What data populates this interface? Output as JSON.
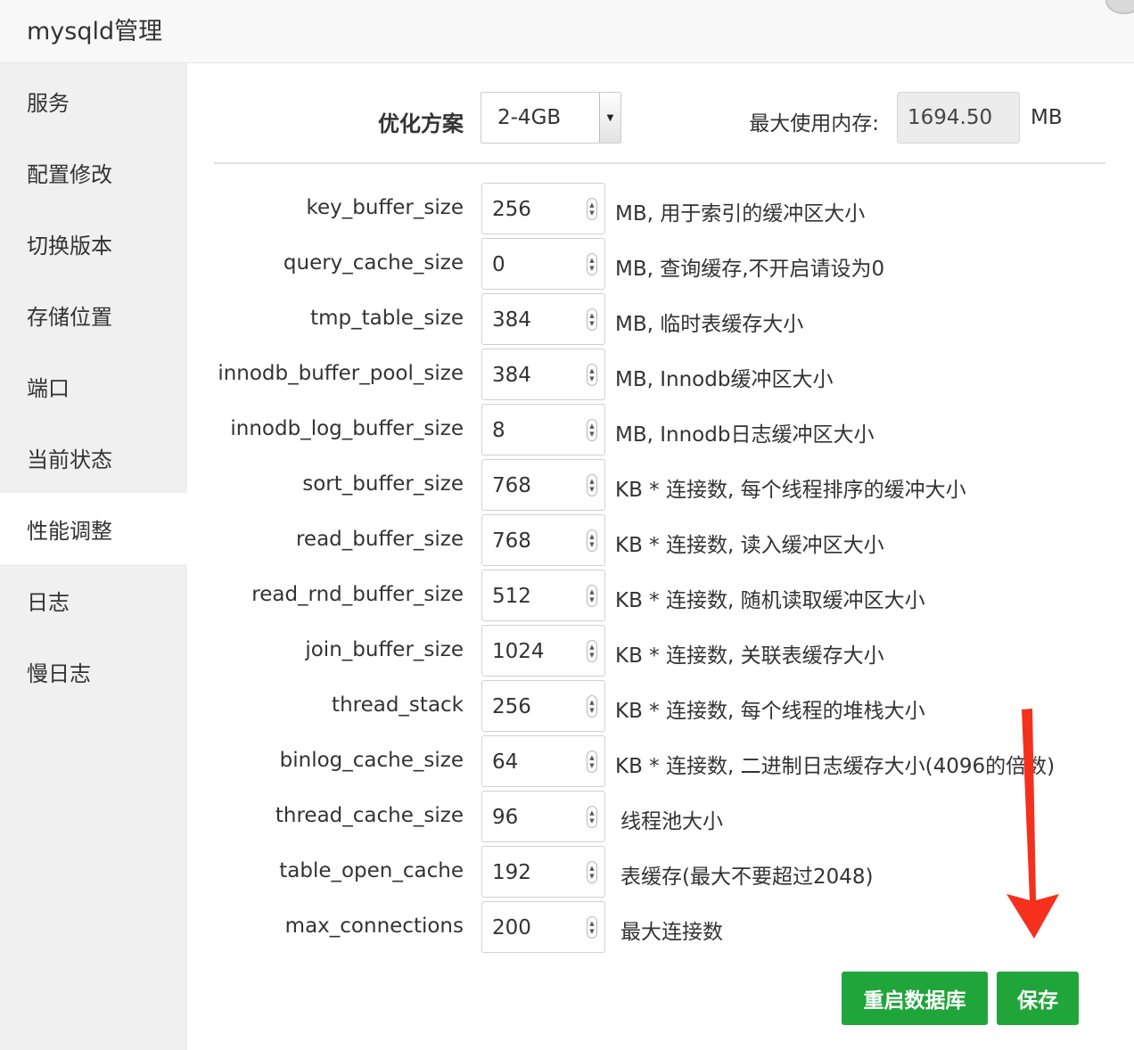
{
  "window": {
    "title": "mysqld管理"
  },
  "sidebar": {
    "items": [
      {
        "label": "服务",
        "active": false
      },
      {
        "label": "配置修改",
        "active": false
      },
      {
        "label": "切换版本",
        "active": false
      },
      {
        "label": "存储位置",
        "active": false
      },
      {
        "label": "端口",
        "active": false
      },
      {
        "label": "当前状态",
        "active": false
      },
      {
        "label": "性能调整",
        "active": true
      },
      {
        "label": "日志",
        "active": false
      },
      {
        "label": "慢日志",
        "active": false
      }
    ]
  },
  "header": {
    "plan_label": "优化方案",
    "plan_value": "2-4GB",
    "max_mem_label": "最大使用内存:",
    "max_mem_value": "1694.50",
    "max_mem_unit": "MB"
  },
  "params": [
    {
      "name": "key_buffer_size",
      "value": "256",
      "desc": "MB, 用于索引的缓冲区大小"
    },
    {
      "name": "query_cache_size",
      "value": "0",
      "desc": "MB, 查询缓存,不开启请设为0"
    },
    {
      "name": "tmp_table_size",
      "value": "384",
      "desc": "MB, 临时表缓存大小"
    },
    {
      "name": "innodb_buffer_pool_size",
      "value": "384",
      "desc": "MB, Innodb缓冲区大小"
    },
    {
      "name": "innodb_log_buffer_size",
      "value": "8",
      "desc": "MB, Innodb日志缓冲区大小"
    },
    {
      "name": "sort_buffer_size",
      "value": "768",
      "desc": "KB * 连接数, 每个线程排序的缓冲大小"
    },
    {
      "name": "read_buffer_size",
      "value": "768",
      "desc": "KB * 连接数, 读入缓冲区大小"
    },
    {
      "name": "read_rnd_buffer_size",
      "value": "512",
      "desc": "KB * 连接数, 随机读取缓冲区大小"
    },
    {
      "name": "join_buffer_size",
      "value": "1024",
      "desc": "KB * 连接数, 关联表缓存大小"
    },
    {
      "name": "thread_stack",
      "value": "256",
      "desc": "KB * 连接数, 每个线程的堆栈大小"
    },
    {
      "name": "binlog_cache_size",
      "value": "64",
      "desc": "KB * 连接数, 二进制日志缓存大小(4096的倍数)"
    },
    {
      "name": "thread_cache_size",
      "value": "96",
      "desc": "线程池大小"
    },
    {
      "name": "table_open_cache",
      "value": "192",
      "desc": "表缓存(最大不要超过2048)"
    },
    {
      "name": "max_connections",
      "value": "200",
      "desc": "最大连接数"
    }
  ],
  "buttons": {
    "restart": "重启数据库",
    "save": "保存"
  },
  "colors": {
    "primary_green": "#20a53a",
    "annotation_arrow": "#f5311e"
  },
  "icons": {
    "spinner": "spinner-arrows-icon",
    "dropdown": "dropdown-arrow-icon",
    "annotation": "red-arrow-icon"
  }
}
